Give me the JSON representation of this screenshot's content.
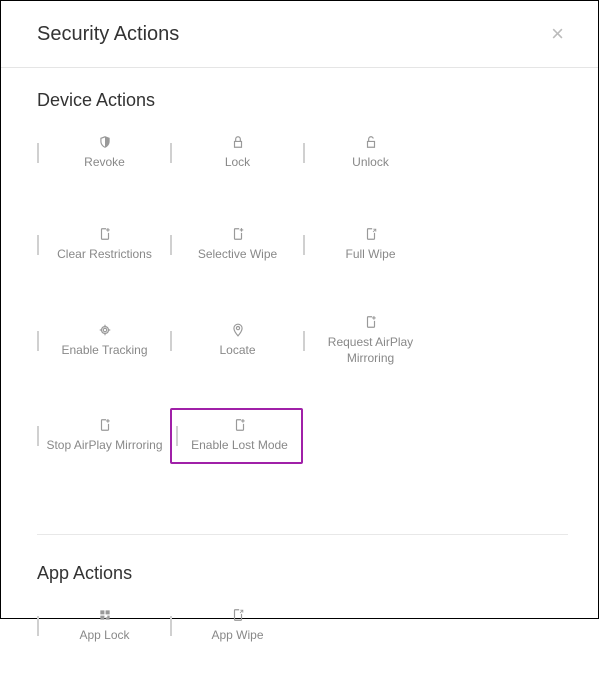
{
  "header": {
    "title": "Security Actions"
  },
  "sections": {
    "device": {
      "title": "Device Actions",
      "actions": {
        "revoke": "Revoke",
        "lock": "Lock",
        "unlock": "Unlock",
        "clear_restrictions": "Clear Restrictions",
        "selective_wipe": "Selective Wipe",
        "full_wipe": "Full Wipe",
        "enable_tracking": "Enable Tracking",
        "locate": "Locate",
        "request_airplay": "Request AirPlay Mirroring",
        "stop_airplay": "Stop AirPlay Mirroring",
        "enable_lost_mode": "Enable Lost Mode"
      }
    },
    "app": {
      "title": "App Actions",
      "actions": {
        "app_lock": "App Lock",
        "app_wipe": "App Wipe"
      }
    }
  }
}
